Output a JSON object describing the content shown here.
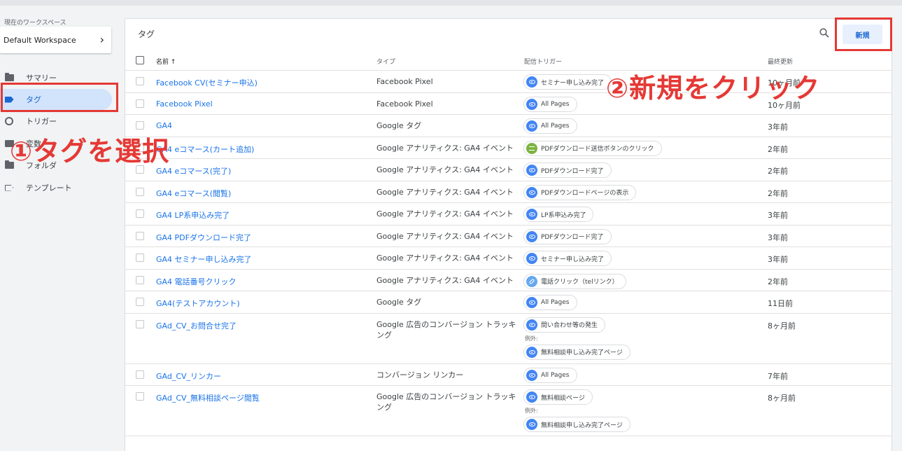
{
  "sidebar": {
    "workspace_label": "現在のワークスペース",
    "workspace_name": "Default Workspace",
    "items": [
      {
        "label": "サマリー",
        "icon": "folder-icon"
      },
      {
        "label": "タグ",
        "icon": "tag-icon"
      },
      {
        "label": "トリガー",
        "icon": "trigger-icon"
      },
      {
        "label": "変数",
        "icon": "variable-icon"
      },
      {
        "label": "フォルダ",
        "icon": "folder-icon"
      },
      {
        "label": "テンプレート",
        "icon": "template-icon"
      }
    ]
  },
  "annotations": {
    "step1": "①タグを選択",
    "step2": "②新規をクリック",
    "color": "#e53935"
  },
  "main": {
    "title": "タグ",
    "new_button": "新規",
    "columns": {
      "name": "名前 ↑",
      "type": "タイプ",
      "trigger": "配信トリガー",
      "updated": "最終更新"
    },
    "exception_label": "例外:",
    "rows": [
      {
        "name": "Facebook CV(セミナー申込)",
        "type": "Facebook Pixel",
        "trigger": "セミナー申し込み完了",
        "trigger_icon": "eye-icon",
        "updated": "10ヶ月前"
      },
      {
        "name": "Facebook Pixel",
        "type": "Facebook Pixel",
        "trigger": "All Pages",
        "trigger_icon": "eye-icon",
        "updated": "10ヶ月前"
      },
      {
        "name": "GA4",
        "type": "Google タグ",
        "trigger": "All Pages",
        "trigger_icon": "eye-icon",
        "updated": "3年前"
      },
      {
        "name": "GA4 eコマース(カート追加)",
        "type": "Google アナリティクス: GA4 イベント",
        "trigger": "PDFダウンロード送信ボタンのクリック",
        "trigger_icon": "form-icon",
        "updated": "2年前"
      },
      {
        "name": "GA4 eコマース(完了)",
        "type": "Google アナリティクス: GA4 イベント",
        "trigger": "PDFダウンロード完了",
        "trigger_icon": "eye-icon",
        "updated": "2年前"
      },
      {
        "name": "GA4 eコマース(閲覧)",
        "type": "Google アナリティクス: GA4 イベント",
        "trigger": "PDFダウンロードページの表示",
        "trigger_icon": "eye-icon",
        "updated": "2年前"
      },
      {
        "name": "GA4 LP系申込み完了",
        "type": "Google アナリティクス: GA4 イベント",
        "trigger": "LP系申込み完了",
        "trigger_icon": "eye-icon",
        "updated": "3年前"
      },
      {
        "name": "GA4 PDFダウンロード完了",
        "type": "Google アナリティクス: GA4 イベント",
        "trigger": "PDFダウンロード完了",
        "trigger_icon": "eye-icon",
        "updated": "3年前"
      },
      {
        "name": "GA4 セミナー申し込み完了",
        "type": "Google アナリティクス: GA4 イベント",
        "trigger": "セミナー申し込み完了",
        "trigger_icon": "eye-icon",
        "updated": "3年前"
      },
      {
        "name": "GA4 電話番号クリック",
        "type": "Google アナリティクス: GA4 イベント",
        "trigger": "電話クリック（telリンク）",
        "trigger_icon": "link-icon",
        "updated": "2年前"
      },
      {
        "name": "GA4(テストアカウント)",
        "type": "Google タグ",
        "trigger": "All Pages",
        "trigger_icon": "eye-icon",
        "updated": "11日前"
      },
      {
        "name": "GAd_CV_お問合せ完了",
        "type": "Google 広告のコンバージョン トラッキング",
        "trigger": "問い合わせ等の発生",
        "trigger_icon": "eye-icon",
        "exception": "無料相談申し込み完了ページ",
        "updated": "8ヶ月前"
      },
      {
        "name": "GAd_CV_リンカー",
        "type": "コンバージョン リンカー",
        "trigger": "All Pages",
        "trigger_icon": "eye-icon",
        "updated": "7年前"
      },
      {
        "name": "GAd_CV_無料相談ページ閲覧",
        "type": "Google 広告のコンバージョン トラッキング",
        "trigger": "無料相談ページ",
        "trigger_icon": "eye-icon",
        "exception": "無料相談申し込み完了ページ",
        "updated": "8ヶ月前"
      }
    ]
  }
}
